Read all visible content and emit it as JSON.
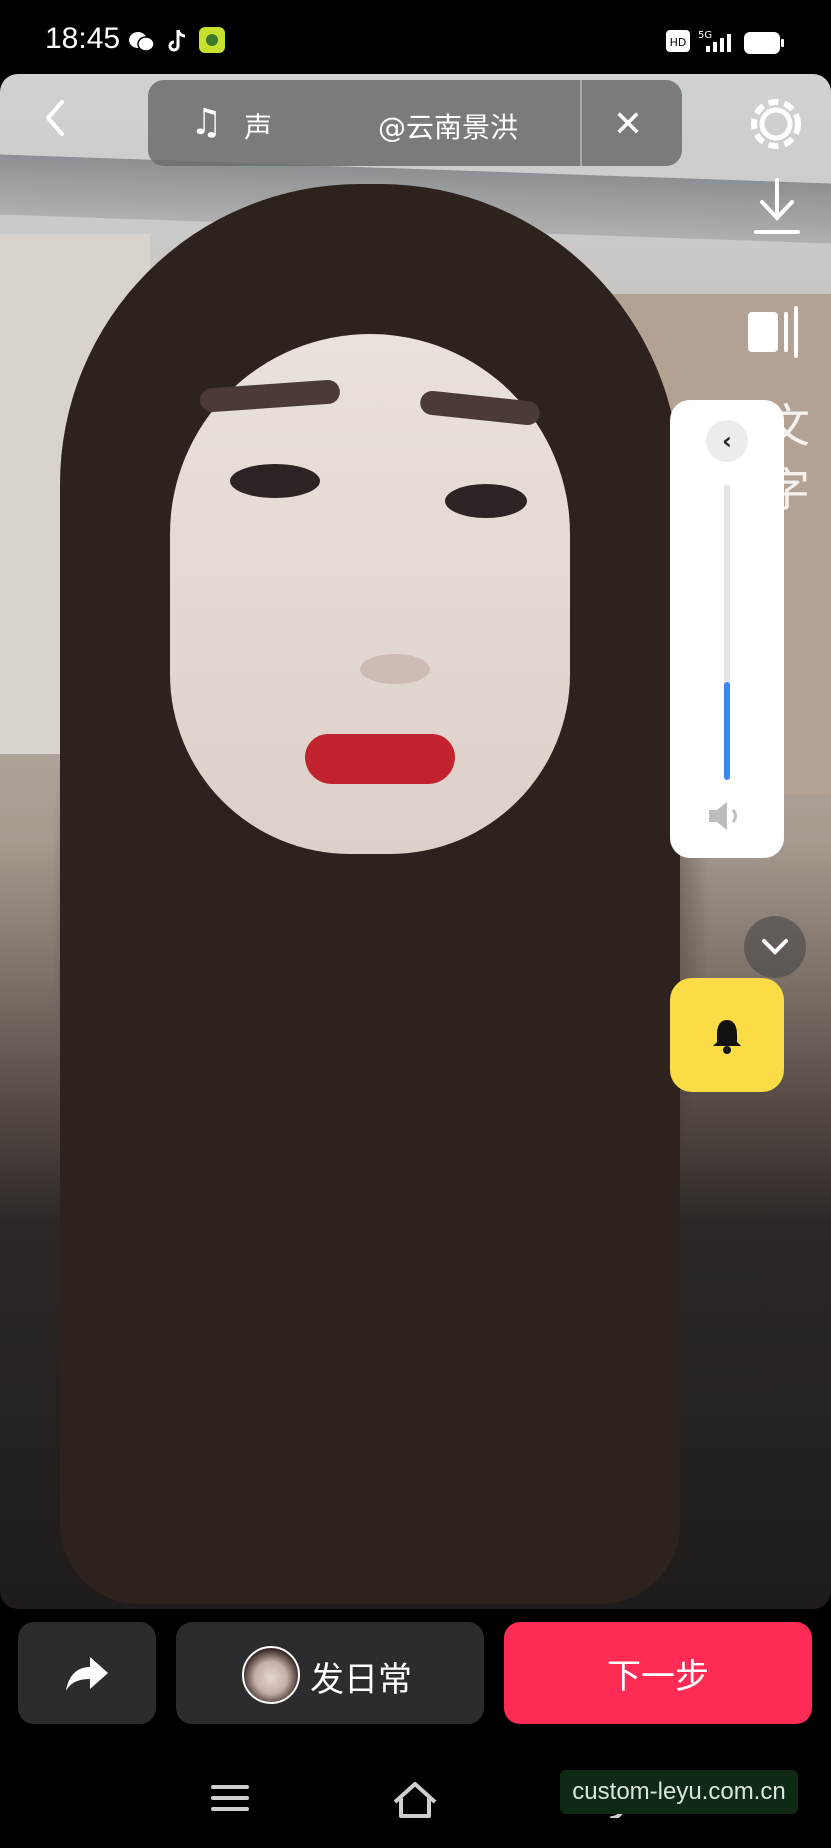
{
  "status_bar": {
    "time": "18:45",
    "left_icons": [
      "wechat-icon",
      "tiktok-icon",
      "app-icon"
    ],
    "right_icons": [
      "hd-icon",
      "5g-signal-icon",
      "battery-icon"
    ],
    "hd_label": "HD",
    "network_label": "5G"
  },
  "top_bar": {
    "music_label": "声",
    "music_author": "@云南景洪",
    "icons": [
      "back-icon",
      "music-note-icon",
      "close-icon",
      "settings-icon",
      "download-icon",
      "filter-icon"
    ]
  },
  "side_text": [
    "文",
    "字"
  ],
  "volume_panel": {
    "level": 0.33,
    "accent_color": "#3a86f2"
  },
  "bottom_actions": {
    "daily_label": "发日常",
    "next_label": "下一步",
    "next_color": "#fe2c55"
  },
  "bell_color": "#fbdc47",
  "watermark": "custom-leyu.com.cn"
}
